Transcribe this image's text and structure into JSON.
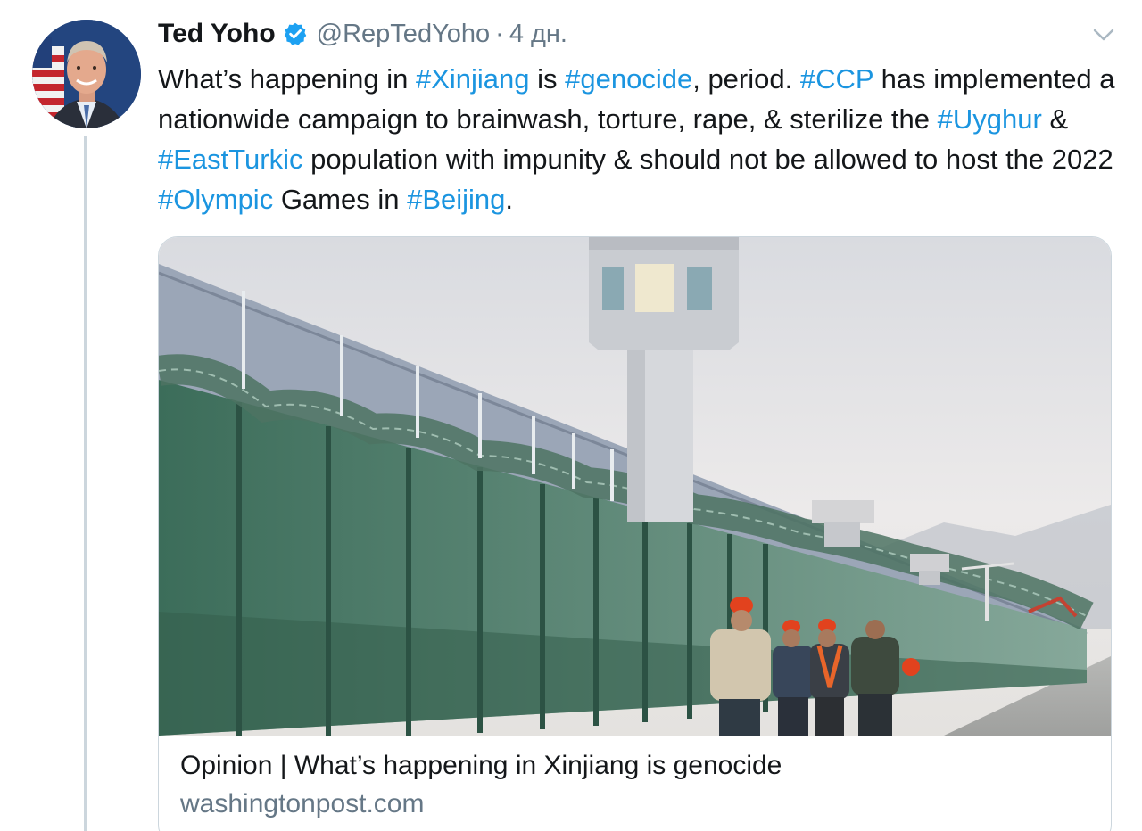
{
  "tweet": {
    "author": {
      "name": "Ted Yoho",
      "handle": "@RepTedYoho",
      "verified": true
    },
    "separator": "·",
    "time": "4 дн.",
    "text_segments": [
      {
        "text": "What’s happening in ",
        "type": "text"
      },
      {
        "text": "#Xinjiang",
        "type": "hashtag"
      },
      {
        "text": " is ",
        "type": "text"
      },
      {
        "text": "#genocide",
        "type": "hashtag"
      },
      {
        "text": ", period. ",
        "type": "text"
      },
      {
        "text": "#CCP",
        "type": "hashtag"
      },
      {
        "text": " has implemented a nationwide campaign to brainwash, torture, rape, & sterilize the ",
        "type": "text"
      },
      {
        "text": "#Uyghur",
        "type": "hashtag"
      },
      {
        "text": " & ",
        "type": "text"
      },
      {
        "text": "#EastTurkic",
        "type": "hashtag"
      },
      {
        "text": " population with impunity & should not be allowed to host the 2022 ",
        "type": "text"
      },
      {
        "text": "#Olympic",
        "type": "hashtag"
      },
      {
        "text": " Games in ",
        "type": "text"
      },
      {
        "text": "#Beijing",
        "type": "hashtag"
      },
      {
        "text": ".",
        "type": "text"
      }
    ],
    "card": {
      "title": "Opinion | What’s happening in Xinjiang is genocide",
      "domain": "washingtonpost.com"
    }
  },
  "icons": {
    "verified": "verified-badge-icon",
    "menu": "chevron-down-icon"
  },
  "colors": {
    "link": "#1b95e0",
    "verified": "#1da1f2",
    "secondary_text": "#657786",
    "thread_line": "#ccd6dd"
  }
}
